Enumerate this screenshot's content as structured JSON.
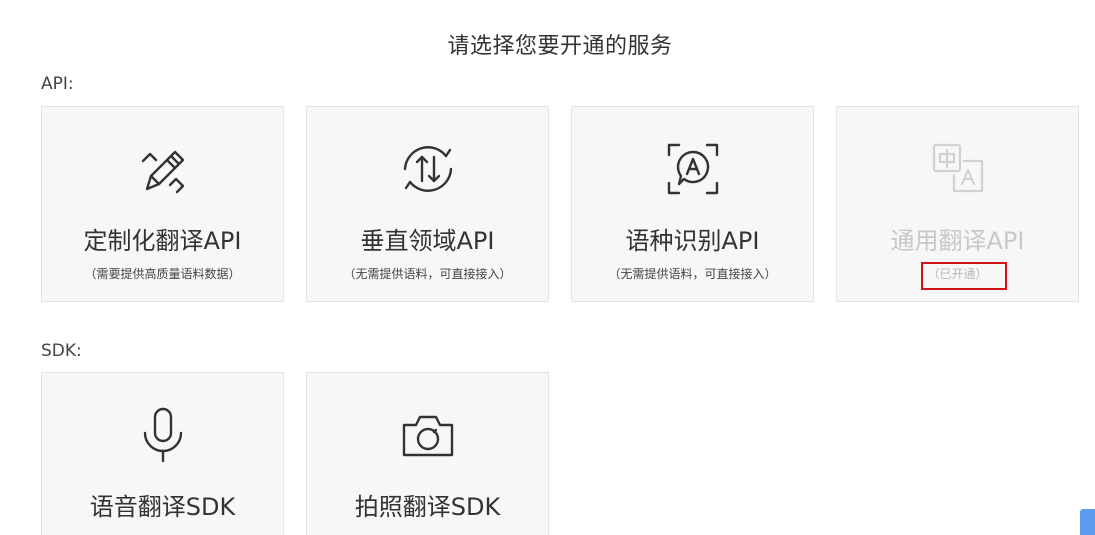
{
  "page": {
    "title": "请选择您要开通的服务"
  },
  "sections": {
    "api_label": "API:",
    "sdk_label": "SDK:"
  },
  "api_cards": [
    {
      "title": "定制化翻译API",
      "desc": "（需要提供高质量语料数据）",
      "icon": "pencil-edit-icon",
      "enabled": true
    },
    {
      "title": "垂直领域API",
      "desc": "（无需提供语料，可直接接入）",
      "icon": "circular-arrows-icon",
      "enabled": true
    },
    {
      "title": "语种识别API",
      "desc": "（无需提供语料，可直接接入）",
      "icon": "language-detect-icon",
      "enabled": true
    },
    {
      "title": "通用翻译API",
      "desc": "（已开通）",
      "icon": "translate-icon",
      "enabled": false
    }
  ],
  "sdk_cards": [
    {
      "title": "语音翻译SDK",
      "icon": "microphone-icon"
    },
    {
      "title": "拍照翻译SDK",
      "icon": "camera-icon"
    }
  ],
  "colors": {
    "card_bg": "#f7f7f7",
    "card_border": "#e3e3e3",
    "highlight_box": "#d0141a",
    "disabled_text": "#c8c8c8",
    "scroll_handle": "#5b9cf0"
  }
}
